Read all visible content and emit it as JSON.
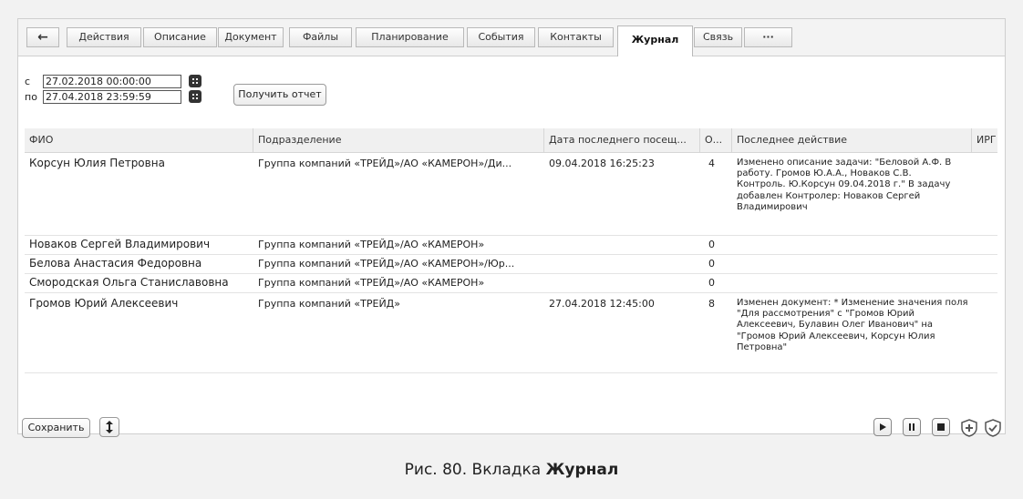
{
  "tabs": [
    {
      "label": "←",
      "name": "tab-back"
    },
    {
      "label": "Действия",
      "name": "tab-actions"
    },
    {
      "label": "Описание",
      "name": "tab-description"
    },
    {
      "label": "Документ",
      "name": "tab-document"
    },
    {
      "label": "Файлы",
      "name": "tab-files"
    },
    {
      "label": "Планирование",
      "name": "tab-planning"
    },
    {
      "label": "События",
      "name": "tab-events"
    },
    {
      "label": "Контакты",
      "name": "tab-contacts"
    },
    {
      "label": "Журнал",
      "name": "tab-journal"
    },
    {
      "label": "Связь",
      "name": "tab-link"
    },
    {
      "label": "···",
      "name": "tab-more"
    }
  ],
  "filter": {
    "from_label": "с",
    "from_value": "27.02.2018 00:00:00",
    "to_label": "по",
    "to_value": "27.04.2018 23:59:59",
    "report_button": "Получить отчет"
  },
  "grid": {
    "columns": [
      "ФИО",
      "Подразделение",
      "Дата последнего посещ...",
      "О...",
      "Последнее действие",
      "ИРГ"
    ],
    "rows": [
      {
        "fio": "Корсун Юлия Петровна",
        "dept": "Группа компаний «ТРЕЙД»/АО «КАМЕРОН»/Ди...",
        "date": "09.04.2018 16:25:23",
        "count": "4",
        "action": "Изменено описание задачи: \"Беловой А.Ф. В работу. Громов Ю.А.А., Новаков С.В. Контроль. Ю.Корсун 09.04.2018 г.\" В задачу добавлен Контролер: Новаков Сергей Владимирович",
        "irg": ""
      },
      {
        "fio": "Новаков Сергей Владимирович",
        "dept": "Группа компаний «ТРЕЙД»/АО «КАМЕРОН»",
        "date": "",
        "count": "0",
        "action": "",
        "irg": ""
      },
      {
        "fio": "Белова Анастасия Федоровна",
        "dept": "Группа компаний «ТРЕЙД»/АО «КАМЕРОН»/Юр...",
        "date": "",
        "count": "0",
        "action": "",
        "irg": ""
      },
      {
        "fio": "Смородская Ольга Станиславовна",
        "dept": "Группа компаний «ТРЕЙД»/АО «КАМЕРОН»",
        "date": "",
        "count": "0",
        "action": "",
        "irg": ""
      },
      {
        "fio": "Громов Юрий Алексеевич",
        "dept": "Группа компаний «ТРЕЙД»",
        "date": "27.04.2018 12:45:00",
        "count": "8",
        "action": "Изменен документ: * Изменение значения поля \"Для рассмотрения\" с \"Громов Юрий Алексеевич, Булавин Олег Иванович\" на \"Громов Юрий Алексеевич, Корсун Юлия Петровна\"",
        "irg": ""
      }
    ]
  },
  "footer": {
    "save_button": "Сохранить",
    "resize_icon": "up-down-arrow-icon",
    "controls": [
      "play-icon",
      "pause-icon",
      "stop-icon",
      "shield-plus-icon",
      "shield-check-icon"
    ]
  },
  "caption": {
    "prefix": "Рис. 80. Вкладка ",
    "bold": "Журнал"
  }
}
